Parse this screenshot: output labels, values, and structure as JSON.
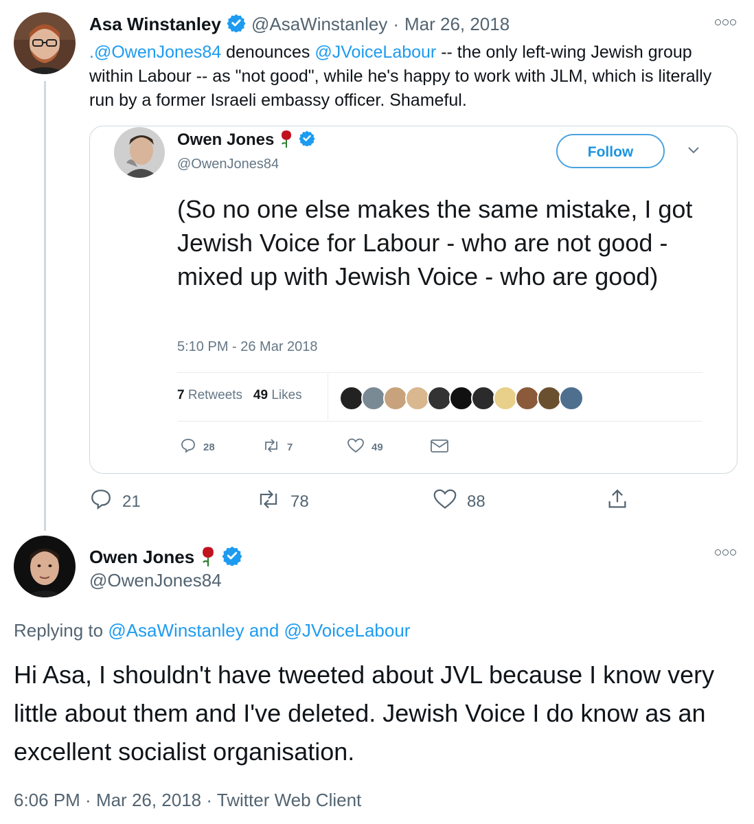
{
  "top_tweet": {
    "author_name": "Asa Winstanley",
    "author_handle": "@AsaWinstanley",
    "separator": "·",
    "date": "Mar 26, 2018",
    "text_parts": [
      ".@OwenJones84",
      " denounces ",
      "@JVoiceLabour",
      "  -- the only left-wing Jewish group within Labour -- as \"not good\", while he's happy to work with JLM, which is literally run by a former Israeli embassy officer. Shameful."
    ],
    "replies": "21",
    "retweets": "78",
    "likes": "88"
  },
  "embedded": {
    "author_name": "Owen Jones",
    "author_handle": "@OwenJones84",
    "follow_label": "Follow",
    "text": "(So no one else makes the same mistake, I got Jewish Voice for Labour - who are not good - mixed up with Jewish Voice - who are good)",
    "timestamp": "5:10 PM - 26 Mar 2018",
    "retweets_count": "7",
    "retweets_label": "Retweets",
    "likes_count": "49",
    "likes_label": "Likes",
    "replies": "28",
    "retweets": "7",
    "likes": "49"
  },
  "reply_tweet": {
    "author_name": "Owen Jones",
    "author_handle": "@OwenJones84",
    "replying_prefix": "Replying to ",
    "replying_user1": "@AsaWinstanley",
    "replying_and": " and ",
    "replying_user2": "@JVoiceLabour",
    "text": "Hi Asa, I shouldn't have tweeted about JVL because I know very little about them and I've deleted. Jewish Voice I do know as an excellent socialist organisation.",
    "time": "6:06 PM",
    "separator1": " · ",
    "date": "Mar 26, 2018",
    "separator2": " · ",
    "client": "Twitter Web Client"
  },
  "colors": {
    "link": "#1d9bf0",
    "verified": "#1d9bf0",
    "rose": "#c1121f"
  },
  "icons": [
    "verified-badge-icon",
    "rose-icon",
    "more-icon",
    "chevron-down-icon",
    "reply-icon",
    "retweet-icon",
    "like-icon",
    "share-icon",
    "mail-icon"
  ]
}
